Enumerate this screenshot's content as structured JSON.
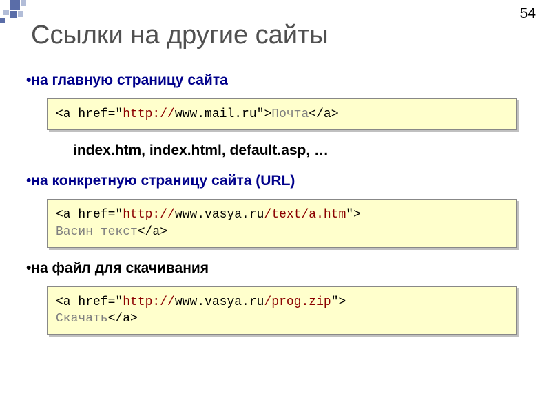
{
  "pageNumber": "54",
  "title": "Ссылки на другие сайты",
  "sections": [
    {
      "bullet": "•на главную страницу сайта",
      "code": {
        "prefix": "<a href=\"",
        "scheme": "http://",
        "rest": "www.mail.ru",
        "close1": "\">",
        "linktext": "Почта",
        "close2": "</a>"
      },
      "index": "index.htm, index.html, default.asp, …"
    },
    {
      "bullet": "•на конкретную страницу сайта (URL)",
      "code": {
        "prefix": "<a href=\"",
        "scheme": "http://",
        "rest": "www.vasya.ru",
        "path": "/text/a.htm",
        "close1": "\">",
        "linktext": "Васин текст",
        "close2": "</a>"
      }
    },
    {
      "bullet": "•на файл для скачивания",
      "code": {
        "prefix": "<a href=\"",
        "scheme": "http://",
        "rest": "www.vasya.ru",
        "path": "/prog.zip",
        "close1": "\">",
        "linktext": "Скачать",
        "close2": "</a>"
      }
    }
  ]
}
